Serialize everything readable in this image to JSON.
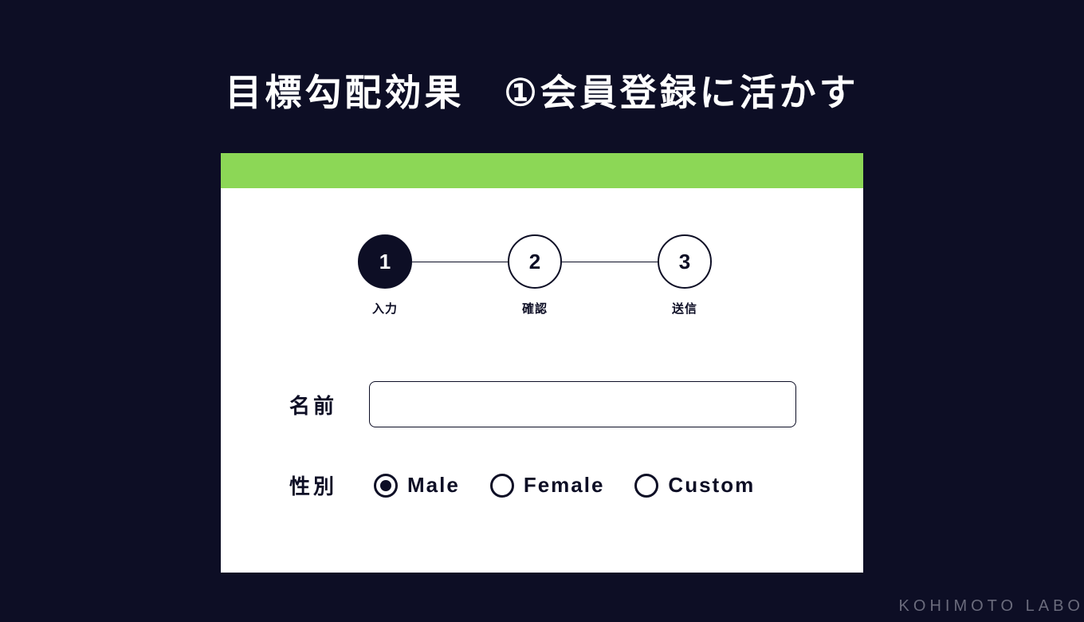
{
  "title_prefix": "目標勾配効果　",
  "title_marker": "①",
  "title_suffix": "会員登録に活かす",
  "steps": [
    {
      "number": "1",
      "label": "入力",
      "active": true
    },
    {
      "number": "2",
      "label": "確認",
      "active": false
    },
    {
      "number": "3",
      "label": "送信",
      "active": false
    }
  ],
  "form": {
    "name_label": "名前",
    "gender_label": "性別",
    "gender_options": [
      {
        "label": "Male",
        "selected": true
      },
      {
        "label": "Female",
        "selected": false
      },
      {
        "label": "Custom",
        "selected": false
      }
    ]
  },
  "watermark": "KOHIMOTO LABO"
}
